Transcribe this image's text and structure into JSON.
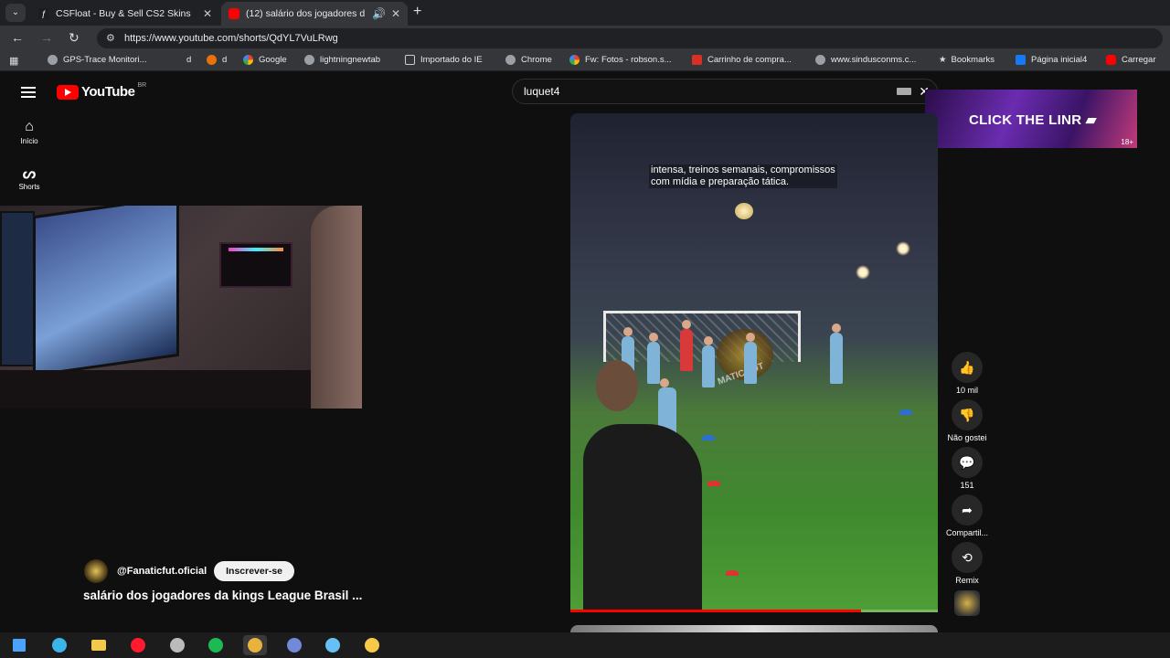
{
  "browser": {
    "tabs": [
      {
        "title": "CSFloat - Buy & Sell CS2 Skins",
        "active": false
      },
      {
        "title": "(12) salário dos jogadores d",
        "active": true
      }
    ],
    "url": "https://www.youtube.com/shorts/QdYL7VuLRwg",
    "bookmarks": [
      {
        "label": "GPS-Trace Monitori...",
        "icon": "gps-icon"
      },
      {
        "label": "d",
        "icon": "text"
      },
      {
        "label": "d",
        "icon": "fox-icon"
      },
      {
        "label": "Google",
        "icon": "google-icon"
      },
      {
        "label": "lightningnewtab",
        "icon": "globe-icon"
      },
      {
        "label": "Importado do IE",
        "icon": "folder-icon"
      },
      {
        "label": "Chrome",
        "icon": "chrome-icon"
      },
      {
        "label": "Fw: Fotos - robson.s...",
        "icon": "google-icon"
      },
      {
        "label": "Carrinho de compra...",
        "icon": "cart-icon"
      },
      {
        "label": "www.sindusconms.c...",
        "icon": "globe-icon"
      },
      {
        "label": "Bookmarks",
        "icon": "star-icon"
      },
      {
        "label": "Página inicial4",
        "icon": "facebook-icon"
      },
      {
        "label": "Carregar",
        "icon": "youtube-icon"
      }
    ]
  },
  "youtube": {
    "logo": "YouTube",
    "country": "BR",
    "nav": [
      {
        "label": "Início",
        "icon": "home-icon"
      },
      {
        "label": "Shorts",
        "icon": "shorts-icon"
      }
    ],
    "search_value": "luquet4",
    "ad_text": "CLICK THE LINR ▰",
    "ad_age": "18+",
    "caption": "intensa, treinos semanais, compromissos\ncom mídia e preparação tática.",
    "watermark": "MATIC FUT",
    "progress": 0.79,
    "actions": [
      {
        "label": "10 mil",
        "icon": "like-icon",
        "glyph": "👍"
      },
      {
        "label": "Não gostei",
        "icon": "dislike-icon",
        "glyph": "👎"
      },
      {
        "label": "151",
        "icon": "comment-icon",
        "glyph": "💬"
      },
      {
        "label": "Compartil...",
        "icon": "share-icon",
        "glyph": "➦"
      },
      {
        "label": "Remix",
        "icon": "remix-icon",
        "glyph": "⟲"
      }
    ],
    "channel": "@Fanaticfut.oficial",
    "subscribe": "Inscrever-se",
    "video_title": "salário dos jogadores da kings League Brasil ..."
  },
  "taskbar": [
    {
      "name": "windows-start-icon",
      "color": "#4aa3ff"
    },
    {
      "name": "edge-icon",
      "color": "#3bb4e8"
    },
    {
      "name": "file-explorer-icon",
      "color": "#f2c94c"
    },
    {
      "name": "opera-icon",
      "color": "#ff1b2d"
    },
    {
      "name": "app-icon",
      "color": "#bbbbbb"
    },
    {
      "name": "spotify-icon",
      "color": "#1db954"
    },
    {
      "name": "chrome-icon",
      "color": "#e8b33a"
    },
    {
      "name": "discord-icon",
      "color": "#7289da"
    },
    {
      "name": "steam-icon",
      "color": "#66c0f4"
    },
    {
      "name": "app-icon-2",
      "color": "#f7c948"
    }
  ]
}
